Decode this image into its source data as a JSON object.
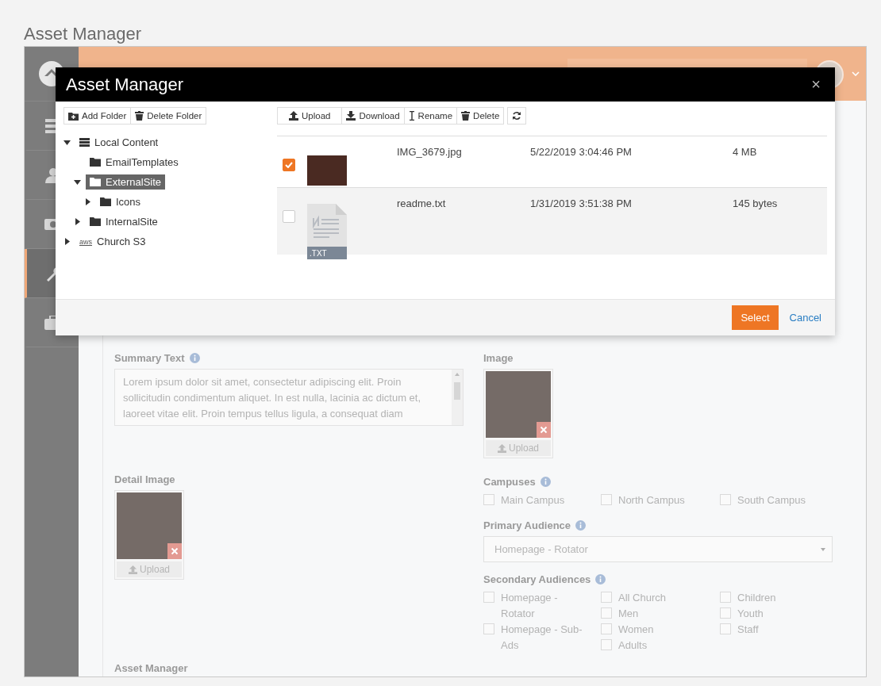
{
  "page_title": "Asset Manager",
  "sidebar": {
    "items": [
      {
        "kind": "list",
        "selected": false
      },
      {
        "kind": "person",
        "selected": false
      },
      {
        "kind": "money",
        "selected": false
      },
      {
        "kind": "wrench",
        "selected": true
      },
      {
        "kind": "briefcase",
        "selected": false
      }
    ]
  },
  "form": {
    "summary": {
      "label": "Summary Text",
      "value": "Lorem ipsum dolor sit amet, consectetur adipiscing elit. Proin sollicitudin condimentum aliquet. In est nulla, lacinia ac dictum et, laoreet vitae elit. Proin tempus tellus ligula, a consequat diam"
    },
    "image": {
      "label": "Image",
      "upload": "Upload"
    },
    "detail_image": {
      "label": "Detail Image",
      "upload": "Upload"
    },
    "campuses": {
      "label": "Campuses",
      "options": [
        {
          "label": "Main Campus",
          "checked": false
        },
        {
          "label": "North Campus",
          "checked": false
        },
        {
          "label": "South Campus",
          "checked": false
        }
      ]
    },
    "primary_audience": {
      "label": "Primary Audience",
      "value": "Homepage - Rotator"
    },
    "secondary_audiences": {
      "label": "Secondary Audiences",
      "columns": [
        {
          "options": [
            {
              "label": "Homepage - Rotator",
              "checked": false
            },
            {
              "label": "Homepage - Sub-Ads",
              "checked": false
            }
          ]
        },
        {
          "options": [
            {
              "label": "All Church",
              "checked": false
            },
            {
              "label": "Men",
              "checked": false
            },
            {
              "label": "Women",
              "checked": false
            },
            {
              "label": "Adults",
              "checked": false
            }
          ]
        },
        {
          "options": [
            {
              "label": "Children",
              "checked": false
            },
            {
              "label": "Youth",
              "checked": false
            },
            {
              "label": "Staff",
              "checked": false
            }
          ]
        }
      ]
    },
    "bottom_label": "Asset Manager"
  },
  "modal": {
    "title": "Asset Manager",
    "close": "×",
    "folder_toolbar": [
      {
        "kind": "add",
        "label": "Add Folder"
      },
      {
        "kind": "delete",
        "label": "Delete Folder"
      }
    ],
    "tree": [
      {
        "label": "Local Content",
        "kind": "server",
        "expanded": true,
        "selected": false,
        "children": [
          {
            "label": "EmailTemplates",
            "kind": "leaf",
            "expanded": false,
            "selected": false
          },
          {
            "label": "ExternalSite",
            "kind": "folder",
            "expanded": true,
            "selected": true,
            "children": [
              {
                "label": "Icons",
                "kind": "folder",
                "expanded": false,
                "selected": false
              }
            ]
          },
          {
            "label": "InternalSite",
            "kind": "folder",
            "expanded": false,
            "selected": false
          }
        ]
      },
      {
        "label": "Church S3",
        "kind": "aws",
        "badge": "aws",
        "expanded": false,
        "selected": false
      }
    ],
    "file_toolbar": [
      {
        "kind": "upload",
        "label": "Upload"
      },
      {
        "kind": "download",
        "label": "Download"
      },
      {
        "kind": "rename",
        "label": "Rename"
      },
      {
        "kind": "delete",
        "label": "Delete"
      }
    ],
    "files": [
      {
        "kind": "image",
        "name": "IMG_3679.jpg",
        "date": "5/22/2019 3:04:46 PM",
        "size": "4 MB",
        "checked": true
      },
      {
        "kind": "text",
        "badge": ".TXT",
        "name": "readme.txt",
        "date": "1/31/2019 3:51:38 PM",
        "size": "145 bytes",
        "checked": false
      }
    ],
    "select_button": "Select",
    "cancel_link": "Cancel"
  }
}
